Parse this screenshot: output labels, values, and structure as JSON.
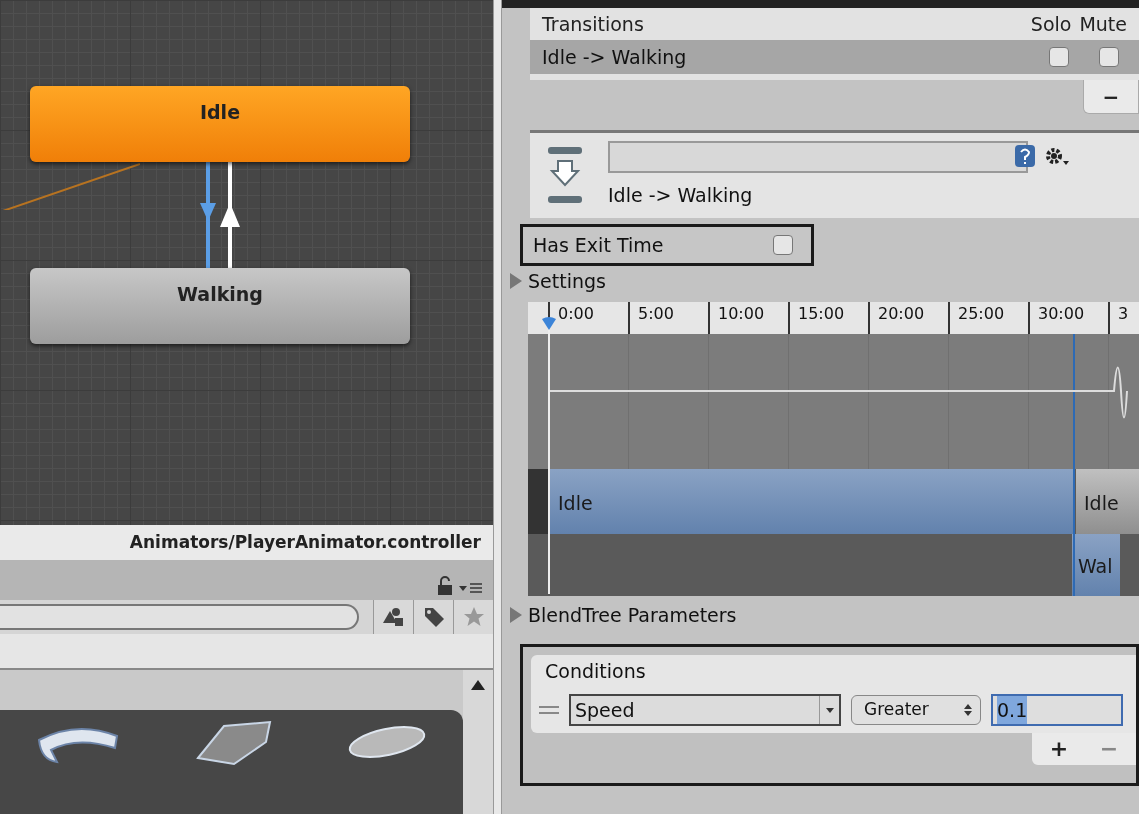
{
  "graph": {
    "states": [
      {
        "name": "Idle",
        "kind": "default"
      },
      {
        "name": "Walking",
        "kind": "normal"
      }
    ]
  },
  "path_bar": {
    "text": "Animators/PlayerAnimator.controller"
  },
  "transitions": {
    "title": "Transitions",
    "columns": [
      "Solo",
      "Mute"
    ],
    "rows": [
      {
        "name": "Idle -> Walking",
        "solo": false,
        "mute": false,
        "selected": true
      }
    ],
    "remove_button": "−"
  },
  "inspector": {
    "title": "Idle -> Walking"
  },
  "has_exit_time": {
    "label": "Has Exit Time",
    "checked": false
  },
  "settings": {
    "label": "Settings",
    "expanded": false
  },
  "timeline": {
    "ticks": [
      "0:00",
      "5:00",
      "10:00",
      "15:00",
      "20:00",
      "25:00",
      "30:00",
      "3"
    ],
    "clips": [
      {
        "label": "Idle",
        "kind": "source"
      },
      {
        "label": "Idle",
        "kind": "target"
      },
      {
        "label": "Wal",
        "kind": "next"
      }
    ]
  },
  "blendtree": {
    "label": "BlendTree Parameters",
    "expanded": false
  },
  "conditions": {
    "title": "Conditions",
    "rows": [
      {
        "parameter": "Speed",
        "mode": "Greater",
        "value": "0.1"
      }
    ],
    "buttons": [
      "+",
      "−"
    ]
  }
}
